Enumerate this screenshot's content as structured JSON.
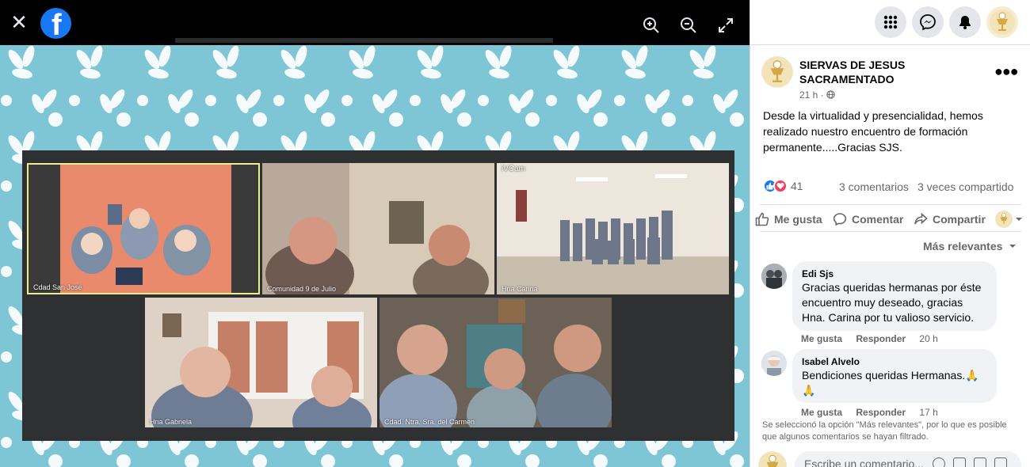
{
  "viewer": {
    "close_glyph": "✕",
    "logo_letter": "f",
    "icons": [
      "zoom-in-icon",
      "zoom-out-icon",
      "fullscreen-icon"
    ],
    "tiles": [
      {
        "label": "Cdad San José"
      },
      {
        "label": "Comunidad 9 de Julio"
      },
      {
        "label": "iVCam"
      },
      {
        "label": "Hna Carina"
      },
      {
        "label": "Hna Gabriela"
      },
      {
        "label": "Cdad. Ntra. Sra. del Carmen"
      }
    ]
  },
  "header": {
    "icons": [
      "menu-grid-icon",
      "messenger-icon",
      "notifications-bell-icon",
      "profile-avatar"
    ]
  },
  "post": {
    "page_name": "SIERVAS DE JESUS SACRAMENTADO",
    "time": "21 h",
    "audience_icon": "globe-icon",
    "text": "Desde la virtualidad y presencialidad, hemos realizado nuestro encuentro de formación permanente.....Gracias SJS.",
    "reaction_count": "41",
    "comments_count": "3 comentarios",
    "shares_count": "3 veces compartido"
  },
  "actions": {
    "like": "Me gusta",
    "comment": "Comentar",
    "share": "Compartir"
  },
  "comments": {
    "sort_label": "Más relevantes",
    "items": [
      {
        "author": "Edi Sjs",
        "text": "Gracias queridas hermanas por éste encuentro muy deseado, gracias Hna. Carina por tu valioso servicio.",
        "like": "Me gusta",
        "reply": "Responder",
        "time": "20 h"
      },
      {
        "author": "Isabel Alvelo",
        "text": "Bendiciones queridas Hermanas.🙏 🙏",
        "like": "Me gusta",
        "reply": "Responder",
        "time": "17 h"
      }
    ],
    "filter_note": "Se seleccionó la opción \"Más relevantes\", por lo que es posible que algunos comentarios se hayan filtrado.",
    "composer_placeholder": "Escribe un comentario..."
  },
  "colors": {
    "facebook_blue": "#1877f2",
    "photo_background": "#7ec6d6",
    "love_red": "#f33e58"
  }
}
